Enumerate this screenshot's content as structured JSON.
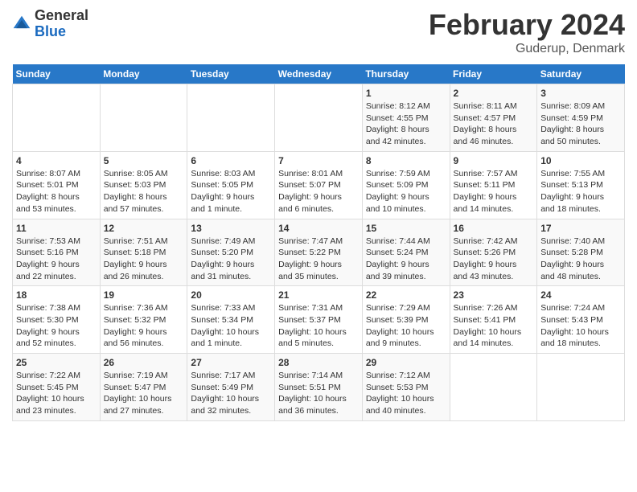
{
  "header": {
    "logo_general": "General",
    "logo_blue": "Blue",
    "month_title": "February 2024",
    "location": "Guderup, Denmark"
  },
  "weekdays": [
    "Sunday",
    "Monday",
    "Tuesday",
    "Wednesday",
    "Thursday",
    "Friday",
    "Saturday"
  ],
  "weeks": [
    [
      {
        "day": "",
        "info": ""
      },
      {
        "day": "",
        "info": ""
      },
      {
        "day": "",
        "info": ""
      },
      {
        "day": "",
        "info": ""
      },
      {
        "day": "1",
        "info": "Sunrise: 8:12 AM\nSunset: 4:55 PM\nDaylight: 8 hours\nand 42 minutes."
      },
      {
        "day": "2",
        "info": "Sunrise: 8:11 AM\nSunset: 4:57 PM\nDaylight: 8 hours\nand 46 minutes."
      },
      {
        "day": "3",
        "info": "Sunrise: 8:09 AM\nSunset: 4:59 PM\nDaylight: 8 hours\nand 50 minutes."
      }
    ],
    [
      {
        "day": "4",
        "info": "Sunrise: 8:07 AM\nSunset: 5:01 PM\nDaylight: 8 hours\nand 53 minutes."
      },
      {
        "day": "5",
        "info": "Sunrise: 8:05 AM\nSunset: 5:03 PM\nDaylight: 8 hours\nand 57 minutes."
      },
      {
        "day": "6",
        "info": "Sunrise: 8:03 AM\nSunset: 5:05 PM\nDaylight: 9 hours\nand 1 minute."
      },
      {
        "day": "7",
        "info": "Sunrise: 8:01 AM\nSunset: 5:07 PM\nDaylight: 9 hours\nand 6 minutes."
      },
      {
        "day": "8",
        "info": "Sunrise: 7:59 AM\nSunset: 5:09 PM\nDaylight: 9 hours\nand 10 minutes."
      },
      {
        "day": "9",
        "info": "Sunrise: 7:57 AM\nSunset: 5:11 PM\nDaylight: 9 hours\nand 14 minutes."
      },
      {
        "day": "10",
        "info": "Sunrise: 7:55 AM\nSunset: 5:13 PM\nDaylight: 9 hours\nand 18 minutes."
      }
    ],
    [
      {
        "day": "11",
        "info": "Sunrise: 7:53 AM\nSunset: 5:16 PM\nDaylight: 9 hours\nand 22 minutes."
      },
      {
        "day": "12",
        "info": "Sunrise: 7:51 AM\nSunset: 5:18 PM\nDaylight: 9 hours\nand 26 minutes."
      },
      {
        "day": "13",
        "info": "Sunrise: 7:49 AM\nSunset: 5:20 PM\nDaylight: 9 hours\nand 31 minutes."
      },
      {
        "day": "14",
        "info": "Sunrise: 7:47 AM\nSunset: 5:22 PM\nDaylight: 9 hours\nand 35 minutes."
      },
      {
        "day": "15",
        "info": "Sunrise: 7:44 AM\nSunset: 5:24 PM\nDaylight: 9 hours\nand 39 minutes."
      },
      {
        "day": "16",
        "info": "Sunrise: 7:42 AM\nSunset: 5:26 PM\nDaylight: 9 hours\nand 43 minutes."
      },
      {
        "day": "17",
        "info": "Sunrise: 7:40 AM\nSunset: 5:28 PM\nDaylight: 9 hours\nand 48 minutes."
      }
    ],
    [
      {
        "day": "18",
        "info": "Sunrise: 7:38 AM\nSunset: 5:30 PM\nDaylight: 9 hours\nand 52 minutes."
      },
      {
        "day": "19",
        "info": "Sunrise: 7:36 AM\nSunset: 5:32 PM\nDaylight: 9 hours\nand 56 minutes."
      },
      {
        "day": "20",
        "info": "Sunrise: 7:33 AM\nSunset: 5:34 PM\nDaylight: 10 hours\nand 1 minute."
      },
      {
        "day": "21",
        "info": "Sunrise: 7:31 AM\nSunset: 5:37 PM\nDaylight: 10 hours\nand 5 minutes."
      },
      {
        "day": "22",
        "info": "Sunrise: 7:29 AM\nSunset: 5:39 PM\nDaylight: 10 hours\nand 9 minutes."
      },
      {
        "day": "23",
        "info": "Sunrise: 7:26 AM\nSunset: 5:41 PM\nDaylight: 10 hours\nand 14 minutes."
      },
      {
        "day": "24",
        "info": "Sunrise: 7:24 AM\nSunset: 5:43 PM\nDaylight: 10 hours\nand 18 minutes."
      }
    ],
    [
      {
        "day": "25",
        "info": "Sunrise: 7:22 AM\nSunset: 5:45 PM\nDaylight: 10 hours\nand 23 minutes."
      },
      {
        "day": "26",
        "info": "Sunrise: 7:19 AM\nSunset: 5:47 PM\nDaylight: 10 hours\nand 27 minutes."
      },
      {
        "day": "27",
        "info": "Sunrise: 7:17 AM\nSunset: 5:49 PM\nDaylight: 10 hours\nand 32 minutes."
      },
      {
        "day": "28",
        "info": "Sunrise: 7:14 AM\nSunset: 5:51 PM\nDaylight: 10 hours\nand 36 minutes."
      },
      {
        "day": "29",
        "info": "Sunrise: 7:12 AM\nSunset: 5:53 PM\nDaylight: 10 hours\nand 40 minutes."
      },
      {
        "day": "",
        "info": ""
      },
      {
        "day": "",
        "info": ""
      }
    ]
  ]
}
